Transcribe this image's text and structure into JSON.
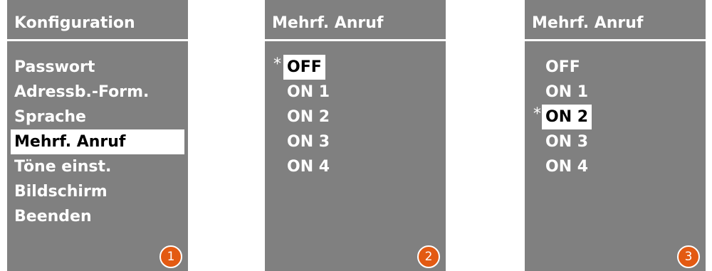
{
  "panels": [
    {
      "title": "Konfiguration",
      "items": [
        "Passwort",
        "Adressb.-Form.",
        "Sprache",
        "Mehrf. Anruf",
        "Töne einst.",
        "Bildschirm",
        "Beenden"
      ],
      "selected_index": 3,
      "marked_index": -1,
      "step": "1"
    },
    {
      "title": "Mehrf. Anruf",
      "items": [
        "OFF",
        "ON 1",
        "ON 2",
        "ON 3",
        "ON 4"
      ],
      "selected_index": 0,
      "marked_index": 0,
      "step": "2"
    },
    {
      "title": "Mehrf. Anruf",
      "items": [
        "OFF",
        "ON 1",
        "ON 2",
        "ON 3",
        "ON 4"
      ],
      "selected_index": 2,
      "marked_index": 2,
      "step": "3"
    }
  ],
  "marker_symbol": "*",
  "colors": {
    "screen_bg": "#808080",
    "text": "#ffffff",
    "highlight_bg": "#ffffff",
    "highlight_text": "#000000",
    "step_badge": "#e35a12"
  }
}
